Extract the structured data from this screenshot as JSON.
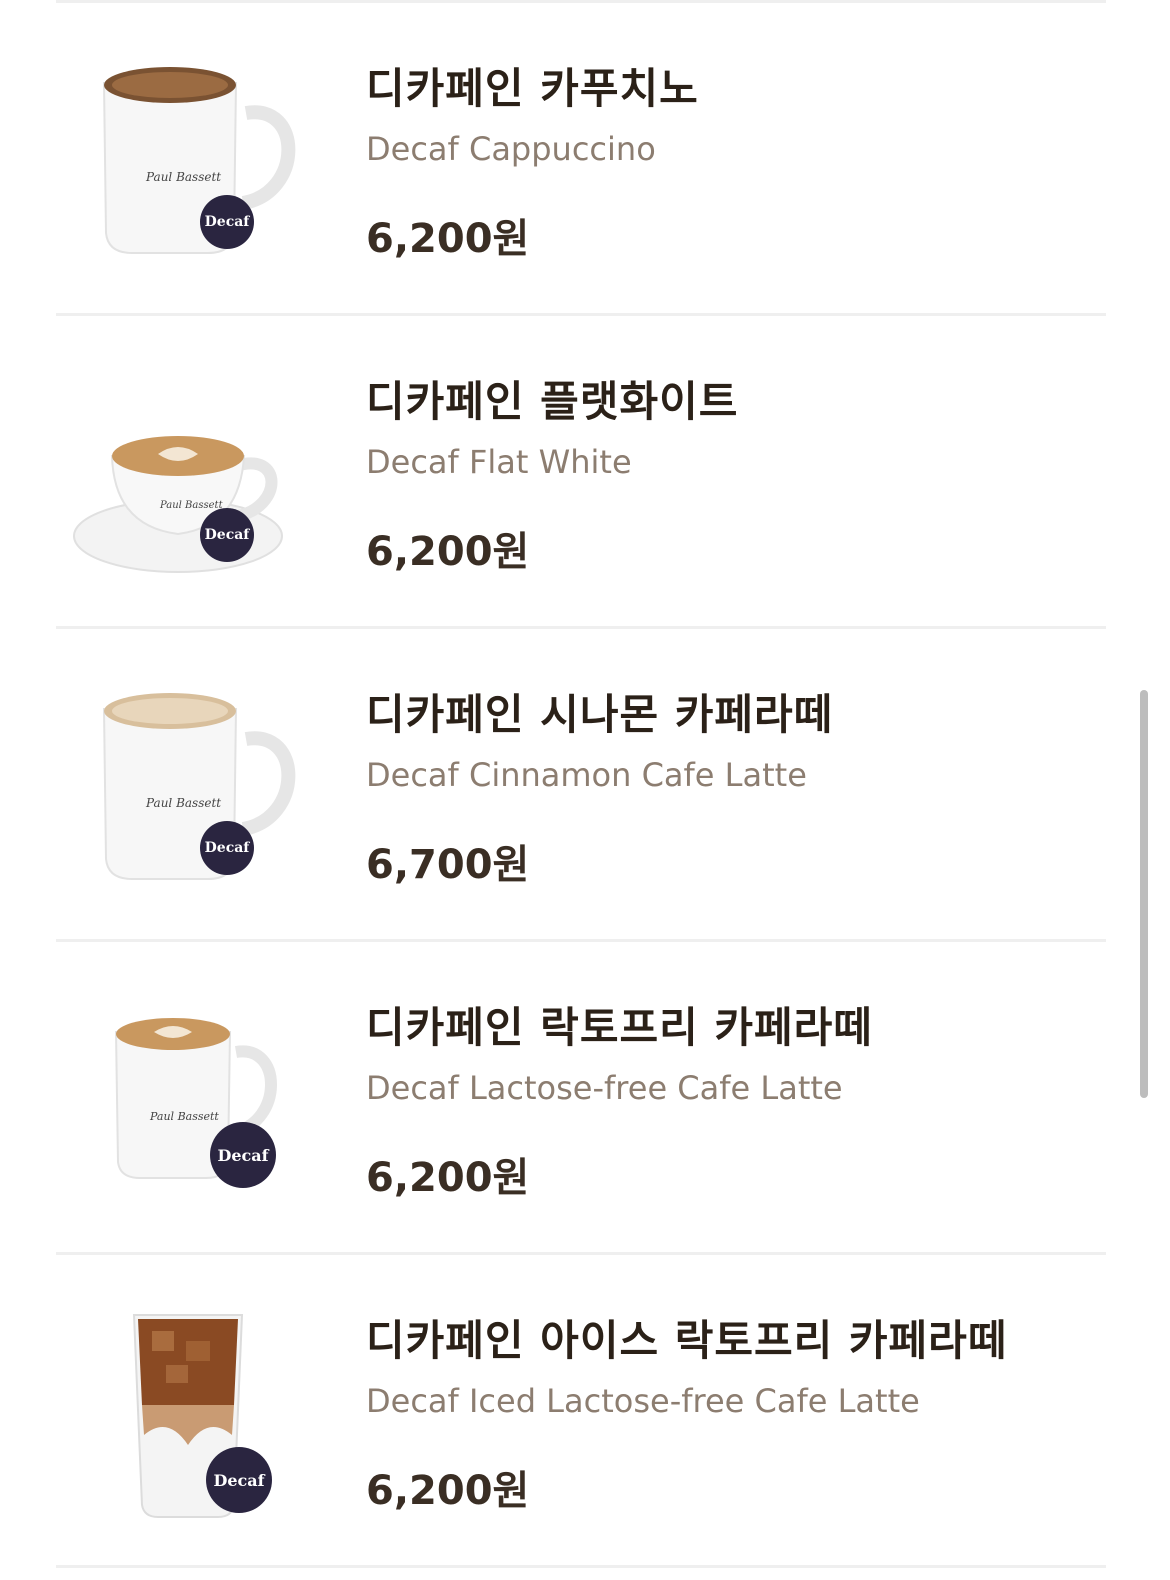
{
  "menu": {
    "items": [
      {
        "name_ko": "디카페인 카푸치노",
        "name_en": "Decaf Cappuccino",
        "price": "6,200원",
        "badge": "Decaf",
        "image": "cappuccino-mug-icon"
      },
      {
        "name_ko": "디카페인 플랫화이트",
        "name_en": "Decaf Flat White",
        "price": "6,200원",
        "badge": "Decaf",
        "image": "flat-white-cup-icon"
      },
      {
        "name_ko": "디카페인 시나몬 카페라떼",
        "name_en": "Decaf Cinnamon Cafe Latte",
        "price": "6,700원",
        "badge": "Decaf",
        "image": "cinnamon-latte-mug-icon"
      },
      {
        "name_ko": "디카페인 락토프리 카페라떼",
        "name_en": "Decaf Lactose-free Cafe Latte",
        "price": "6,200원",
        "badge": "Decaf",
        "image": "lactose-free-latte-mug-icon"
      },
      {
        "name_ko": "디카페인 아이스 락토프리 카페라떼",
        "name_en": "Decaf Iced Lactose-free Cafe Latte",
        "price": "6,200원",
        "badge": "Decaf",
        "image": "iced-latte-glass-icon"
      }
    ]
  },
  "colors": {
    "badge": "#2a2540",
    "title": "#2b2118",
    "subtitle": "#8c7d70",
    "price": "#3a2e24"
  }
}
